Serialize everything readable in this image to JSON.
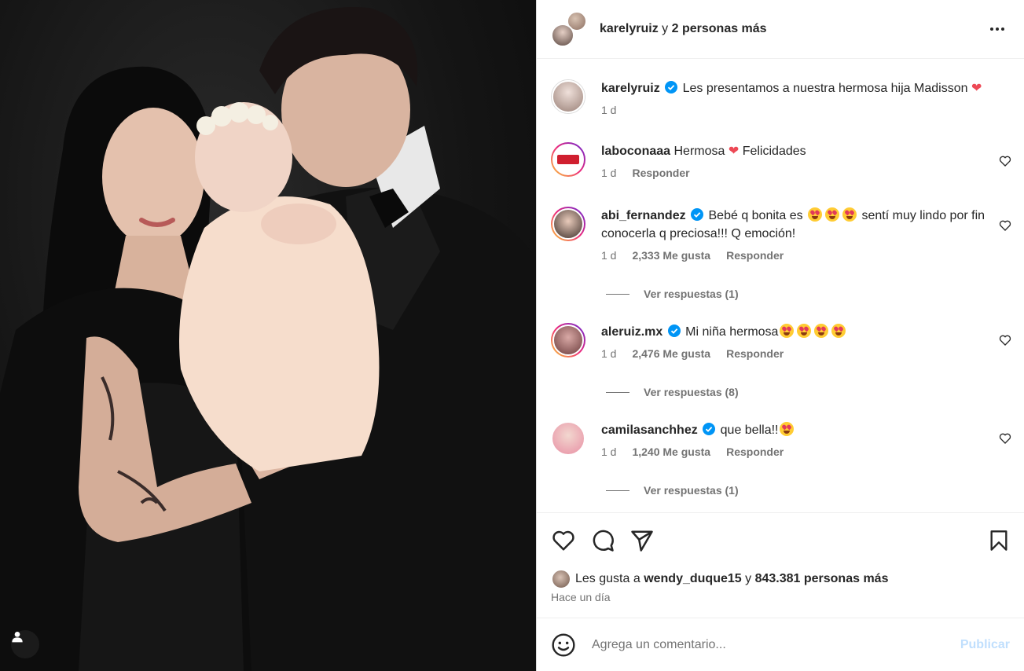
{
  "header": {
    "username": "karelyruiz",
    "connector": "y",
    "others": "2 personas más"
  },
  "caption": {
    "username": "karelyruiz",
    "text": "Les presentamos a nuestra hermosa hija Madisson",
    "time": "1 d"
  },
  "comments": [
    {
      "username": "laboconaaa",
      "text_before": "Hermosa",
      "text_after": "Felicidades",
      "time": "1 d",
      "likes": "",
      "reply_label": "Responder",
      "view_replies": ""
    },
    {
      "username": "abi_fernandez",
      "text_before": "Bebé q bonita es",
      "text_after": "sentí muy lindo por fin conocerla q preciosa!!! Q emoción!",
      "time": "1 d",
      "likes": "2,333 Me gusta",
      "reply_label": "Responder",
      "view_replies": "Ver respuestas (1)"
    },
    {
      "username": "aleruiz.mx",
      "text_before": "Mi niña hermosa",
      "text_after": "",
      "time": "1 d",
      "likes": "2,476 Me gusta",
      "reply_label": "Responder",
      "view_replies": "Ver respuestas (8)"
    },
    {
      "username": "camilasanchhez",
      "text_before": "que bella!!",
      "text_after": "",
      "time": "1 d",
      "likes": "1,240 Me gusta",
      "reply_label": "Responder",
      "view_replies": "Ver respuestas (1)"
    }
  ],
  "likes_line": {
    "prefix": "Les gusta a",
    "user": "wendy_duque15",
    "connector": "y",
    "others": "843.381 personas más"
  },
  "posted_ago": "Hace un día",
  "composer": {
    "placeholder": "Agrega un comentario...",
    "publish_label": "Publicar"
  },
  "icons": {
    "more": "more-horizontal-icon",
    "like": "heart-outline-icon",
    "comment": "comment-bubble-icon",
    "share": "paper-plane-icon",
    "save": "bookmark-icon",
    "emoji": "smiley-icon",
    "verified": "verified-badge-icon",
    "tag": "user-tag-icon"
  },
  "colors": {
    "verified": "#0095f6",
    "heart": "#ed4956",
    "publish_disabled": "#c0dffd",
    "secondary_text": "#737373"
  }
}
